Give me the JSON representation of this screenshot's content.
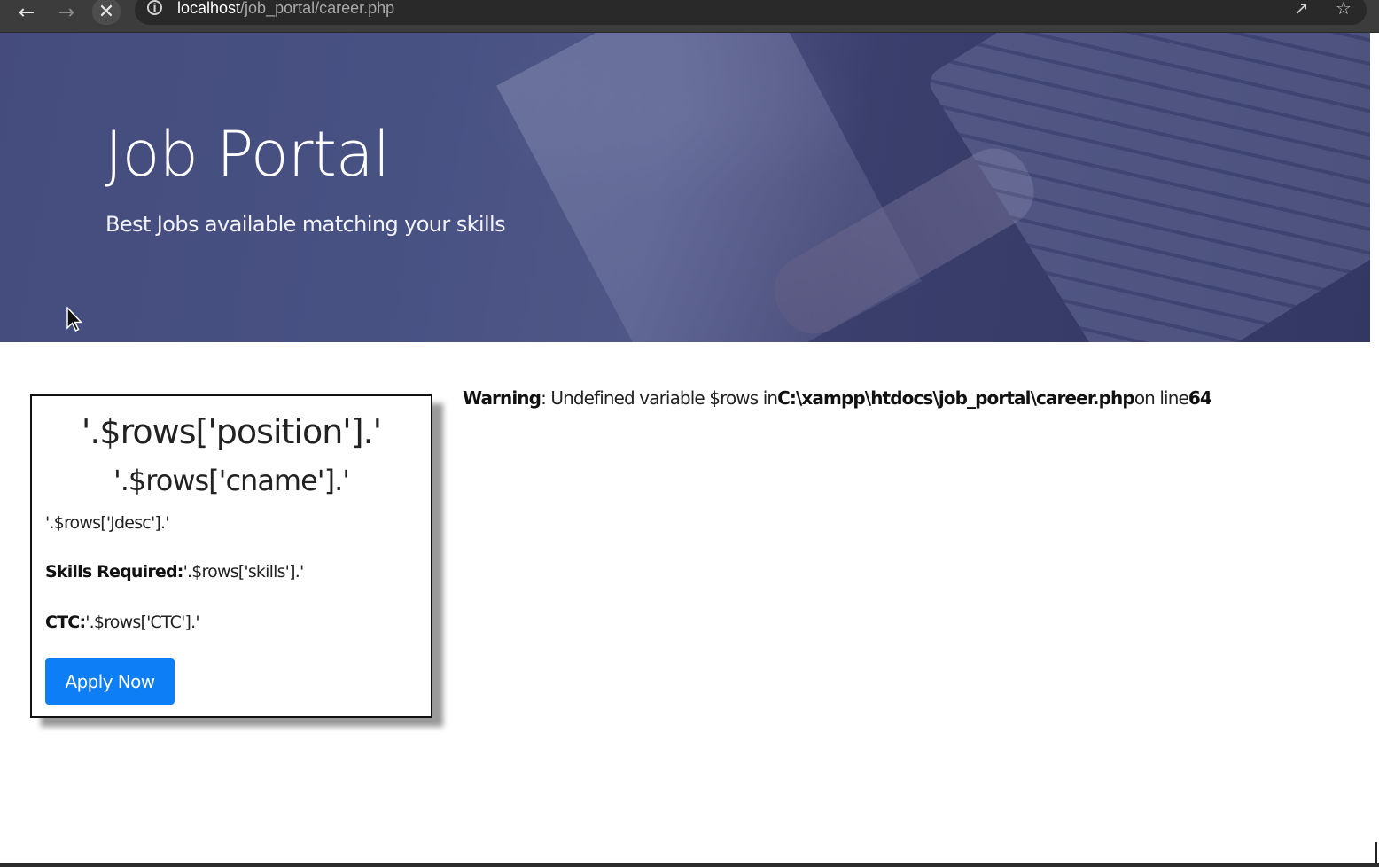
{
  "browser": {
    "url_host": "localhost",
    "url_path": "/job_portal/career.php",
    "back_icon": "arrow-left-icon",
    "forward_icon": "arrow-right-icon",
    "stop_icon": "close-icon",
    "info_icon": "info-icon",
    "share_icon": "share-icon",
    "star_icon": "star-icon"
  },
  "hero": {
    "title": "Job Portal",
    "subtitle": "Best Jobs available matching your skills"
  },
  "card": {
    "position": "'.$rows['position'].'",
    "cname": "'.$rows['cname'].'",
    "description": "'.$rows['Jdesc'].'",
    "skills_label": "Skills Required:",
    "skills_value": "'.$rows['skills'].'",
    "ctc_label": "CTC:",
    "ctc_value": "'.$rows['CTC'].'",
    "apply_label": "Apply Now"
  },
  "warning": {
    "label": "Warning",
    "message": ": Undefined variable $rows in",
    "file": "C:\\xampp\\htdocs\\job_portal\\career.php",
    "line_text": "on line",
    "line_number": "64"
  },
  "colors": {
    "apply_button": "#0d7ef5",
    "hero_tint": "#3c3e78",
    "chrome": "#3c3c3c"
  }
}
